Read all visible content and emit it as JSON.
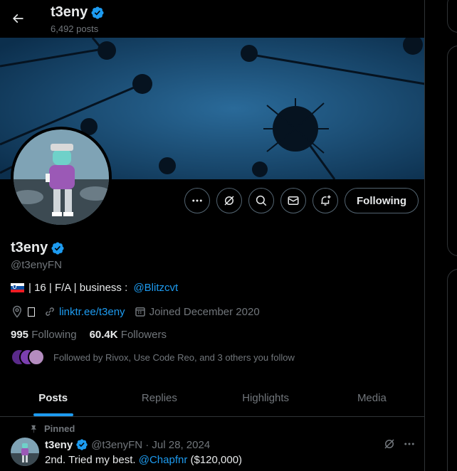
{
  "header": {
    "title": "t3eny",
    "subtitle": "6,492 posts"
  },
  "actions": {
    "following_label": "Following"
  },
  "profile": {
    "name": "t3eny",
    "handle": "@t3enyFN",
    "bio_text": "| 16 | F/A | business : ",
    "bio_link": "@Blitzcvt",
    "website": "linktr.ee/t3eny",
    "joined": "Joined December 2020",
    "following_count": "995",
    "following_label": "Following",
    "followers_count": "60.4K",
    "followers_label": "Followers",
    "followed_by": "Followed by Rivox, Use Code Reo, and 3 others you follow"
  },
  "tabs": [
    {
      "label": "Posts",
      "active": true
    },
    {
      "label": "Replies",
      "active": false
    },
    {
      "label": "Highlights",
      "active": false
    },
    {
      "label": "Media",
      "active": false
    }
  ],
  "post": {
    "pinned_label": "Pinned",
    "name": "t3eny",
    "handle_date": "@t3enyFN · Jul 28, 2024",
    "text_prefix": "2nd. Tried my best. ",
    "text_link": "@Chapfnr",
    "text_suffix": " ($120,000)"
  },
  "colors": {
    "accent": "#1d9bf0",
    "background": "#000000",
    "muted": "#71767b",
    "text": "#e7e9ea",
    "border": "#2f3336"
  },
  "icons": [
    "back-arrow-icon",
    "verified-badge-icon",
    "more-icon",
    "grok-icon",
    "search-icon",
    "message-icon",
    "notification-plus-icon",
    "location-icon",
    "link-icon",
    "calendar-icon",
    "pin-icon"
  ]
}
